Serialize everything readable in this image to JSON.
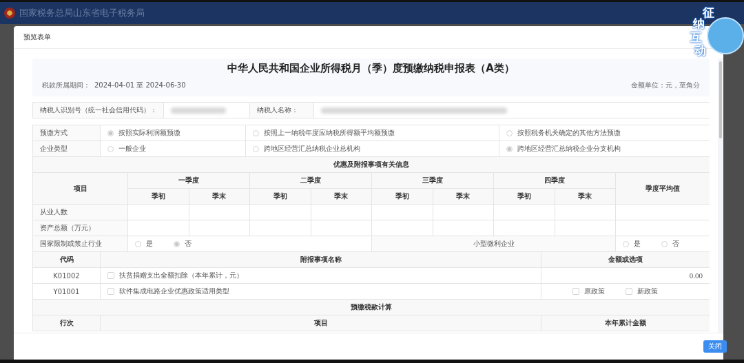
{
  "header": {
    "title": "国家税务总局山东省电子税务局"
  },
  "badge": {
    "chars": [
      "征",
      "纳",
      "互",
      "动"
    ]
  },
  "dialog": {
    "title": "预览表单",
    "close_button": "关闭"
  },
  "form": {
    "title": "中华人民共和国企业所得税月（季）度预缴纳税申报表（A类）",
    "period_label": "税款所属期间：",
    "period": "2024-04-01 至 2024-06-30",
    "unit": "金额单位：元，至角分",
    "taxpayer": [
      {
        "label": "纳税人识别号（统一社会信用代码）："
      },
      {
        "label": "纳税人名称："
      }
    ],
    "option_rows": [
      {
        "label": "预缴方式",
        "options": [
          {
            "label": "按照实际利润额预缴",
            "selected": true
          },
          {
            "label": "按照上一纳税年度应纳税所得额平均额预缴",
            "selected": false
          },
          {
            "label": "按照税务机关确定的其他方法预缴",
            "selected": false
          }
        ]
      },
      {
        "label": "企业类型",
        "options": [
          {
            "label": "一般企业",
            "selected": false
          },
          {
            "label": "跨地区经营汇总纳税企业总机构",
            "selected": false
          },
          {
            "label": "跨地区经营汇总纳税企业分支机构",
            "selected": true
          }
        ]
      }
    ],
    "benefits": {
      "title": "优惠及附报事项有关信息",
      "item_header": "项目",
      "average_header": "季度平均值",
      "quarters": [
        {
          "name": "一季度",
          "cols": [
            "季初",
            "季末"
          ]
        },
        {
          "name": "二季度",
          "cols": [
            "季初",
            "季末"
          ]
        },
        {
          "name": "三季度",
          "cols": [
            "季初",
            "季末"
          ]
        },
        {
          "name": "四季度",
          "cols": [
            "季初",
            "季末"
          ]
        }
      ],
      "rows": [
        {
          "label": "从业人数"
        },
        {
          "label": "资产总额（万元）"
        }
      ],
      "flags": [
        {
          "label": "国家限制或禁止行业",
          "options": [
            {
              "label": "是",
              "selected": false
            },
            {
              "label": "否",
              "selected": true
            }
          ]
        },
        {
          "label": "小型微利企业",
          "options": [
            {
              "label": "是",
              "selected": false
            },
            {
              "label": "否",
              "selected": false
            }
          ]
        }
      ]
    },
    "items": {
      "columns": [
        "代码",
        "附报事项名称",
        "金额或选项"
      ],
      "rows": [
        {
          "code": "K01002",
          "name": "扶贫捐赠支出全额扣除（本年累计，元）",
          "checked": false,
          "kind": "amount",
          "value": "0.00"
        },
        {
          "code": "Y01001",
          "name": "软件集成电路企业优惠政策适用类型",
          "checked": false,
          "kind": "choices",
          "choices": [
            {
              "label": "原政策",
              "checked": false
            },
            {
              "label": "新政策",
              "checked": false
            }
          ]
        }
      ]
    },
    "calc": {
      "title": "预缴税款计算",
      "columns": [
        "行次",
        "项目",
        "本年累计金额"
      ]
    }
  }
}
